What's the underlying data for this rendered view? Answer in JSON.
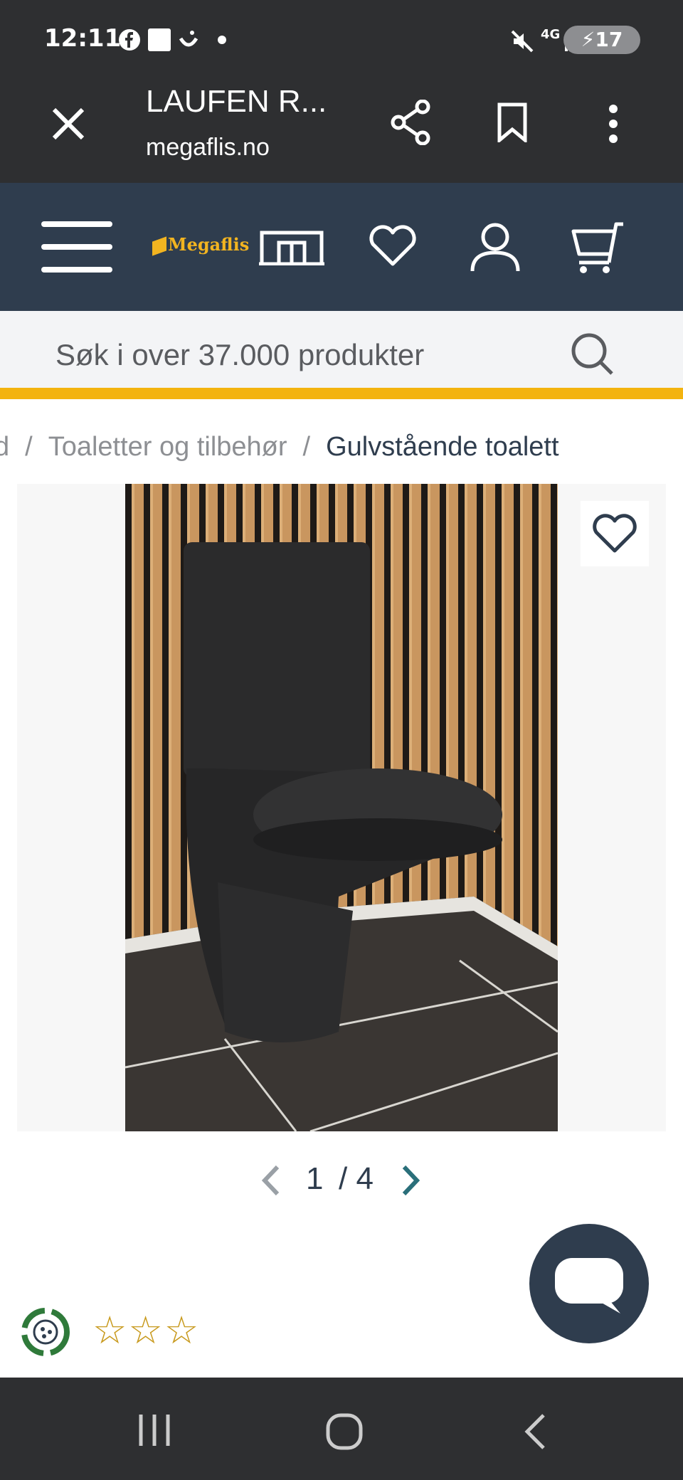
{
  "status_bar": {
    "time": "12:11",
    "network": "4G",
    "battery": "17"
  },
  "custom_tab": {
    "title": "LAUFEN R...",
    "url": "megaflis.no"
  },
  "site_nav": {
    "logo_text": "Megaflis"
  },
  "search": {
    "placeholder": "Søk i over 37.000 produkter"
  },
  "breadcrumb": {
    "items": [
      "d",
      "Toaletter og tilbehør",
      "Gulvstående toalett"
    ],
    "separator": "/"
  },
  "gallery": {
    "current": "1",
    "total": "4"
  },
  "rating": {
    "stars": "☆☆☆"
  },
  "colors": {
    "header_dark": "#2e2f31",
    "nav_blue": "#2f3d4e",
    "accent_yellow": "#f3b30f",
    "teal_arrow": "#2a6f7a"
  }
}
